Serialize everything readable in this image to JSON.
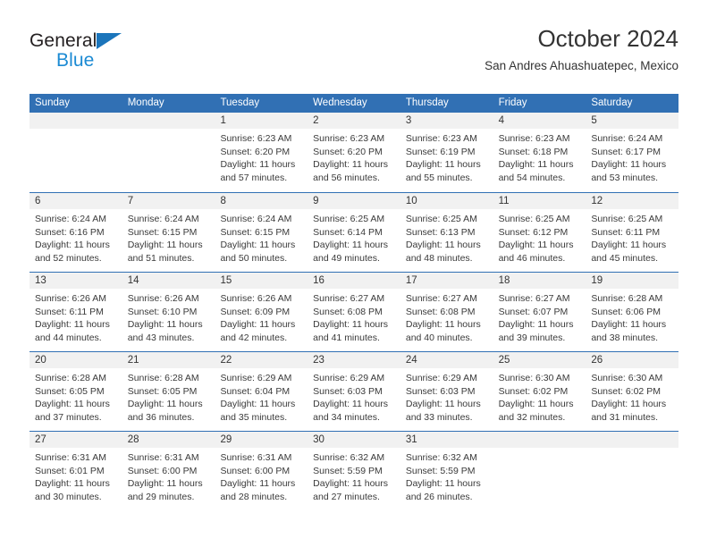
{
  "brand": {
    "name_top": "General",
    "name_bottom": "Blue",
    "triangle_color": "#1b75bb",
    "blue_text_color": "#1b8ad3"
  },
  "header": {
    "title": "October 2024",
    "subtitle": "San Andres Ahuashuatepec, Mexico"
  },
  "theme": {
    "header_blue": "#3170b4",
    "daynum_band": "#f1f1f1",
    "text": "#333333"
  },
  "weekdays": [
    "Sunday",
    "Monday",
    "Tuesday",
    "Wednesday",
    "Thursday",
    "Friday",
    "Saturday"
  ],
  "labels": {
    "sunrise_prefix": "Sunrise: ",
    "sunset_prefix": "Sunset: ",
    "daylight_prefix": "Daylight: "
  },
  "weeks": [
    [
      {
        "day": ""
      },
      {
        "day": ""
      },
      {
        "day": "1",
        "sunrise": "Sunrise: 6:23 AM",
        "sunset": "Sunset: 6:20 PM",
        "daylight": "Daylight: 11 hours and 57 minutes."
      },
      {
        "day": "2",
        "sunrise": "Sunrise: 6:23 AM",
        "sunset": "Sunset: 6:20 PM",
        "daylight": "Daylight: 11 hours and 56 minutes."
      },
      {
        "day": "3",
        "sunrise": "Sunrise: 6:23 AM",
        "sunset": "Sunset: 6:19 PM",
        "daylight": "Daylight: 11 hours and 55 minutes."
      },
      {
        "day": "4",
        "sunrise": "Sunrise: 6:23 AM",
        "sunset": "Sunset: 6:18 PM",
        "daylight": "Daylight: 11 hours and 54 minutes."
      },
      {
        "day": "5",
        "sunrise": "Sunrise: 6:24 AM",
        "sunset": "Sunset: 6:17 PM",
        "daylight": "Daylight: 11 hours and 53 minutes."
      }
    ],
    [
      {
        "day": "6",
        "sunrise": "Sunrise: 6:24 AM",
        "sunset": "Sunset: 6:16 PM",
        "daylight": "Daylight: 11 hours and 52 minutes."
      },
      {
        "day": "7",
        "sunrise": "Sunrise: 6:24 AM",
        "sunset": "Sunset: 6:15 PM",
        "daylight": "Daylight: 11 hours and 51 minutes."
      },
      {
        "day": "8",
        "sunrise": "Sunrise: 6:24 AM",
        "sunset": "Sunset: 6:15 PM",
        "daylight": "Daylight: 11 hours and 50 minutes."
      },
      {
        "day": "9",
        "sunrise": "Sunrise: 6:25 AM",
        "sunset": "Sunset: 6:14 PM",
        "daylight": "Daylight: 11 hours and 49 minutes."
      },
      {
        "day": "10",
        "sunrise": "Sunrise: 6:25 AM",
        "sunset": "Sunset: 6:13 PM",
        "daylight": "Daylight: 11 hours and 48 minutes."
      },
      {
        "day": "11",
        "sunrise": "Sunrise: 6:25 AM",
        "sunset": "Sunset: 6:12 PM",
        "daylight": "Daylight: 11 hours and 46 minutes."
      },
      {
        "day": "12",
        "sunrise": "Sunrise: 6:25 AM",
        "sunset": "Sunset: 6:11 PM",
        "daylight": "Daylight: 11 hours and 45 minutes."
      }
    ],
    [
      {
        "day": "13",
        "sunrise": "Sunrise: 6:26 AM",
        "sunset": "Sunset: 6:11 PM",
        "daylight": "Daylight: 11 hours and 44 minutes."
      },
      {
        "day": "14",
        "sunrise": "Sunrise: 6:26 AM",
        "sunset": "Sunset: 6:10 PM",
        "daylight": "Daylight: 11 hours and 43 minutes."
      },
      {
        "day": "15",
        "sunrise": "Sunrise: 6:26 AM",
        "sunset": "Sunset: 6:09 PM",
        "daylight": "Daylight: 11 hours and 42 minutes."
      },
      {
        "day": "16",
        "sunrise": "Sunrise: 6:27 AM",
        "sunset": "Sunset: 6:08 PM",
        "daylight": "Daylight: 11 hours and 41 minutes."
      },
      {
        "day": "17",
        "sunrise": "Sunrise: 6:27 AM",
        "sunset": "Sunset: 6:08 PM",
        "daylight": "Daylight: 11 hours and 40 minutes."
      },
      {
        "day": "18",
        "sunrise": "Sunrise: 6:27 AM",
        "sunset": "Sunset: 6:07 PM",
        "daylight": "Daylight: 11 hours and 39 minutes."
      },
      {
        "day": "19",
        "sunrise": "Sunrise: 6:28 AM",
        "sunset": "Sunset: 6:06 PM",
        "daylight": "Daylight: 11 hours and 38 minutes."
      }
    ],
    [
      {
        "day": "20",
        "sunrise": "Sunrise: 6:28 AM",
        "sunset": "Sunset: 6:05 PM",
        "daylight": "Daylight: 11 hours and 37 minutes."
      },
      {
        "day": "21",
        "sunrise": "Sunrise: 6:28 AM",
        "sunset": "Sunset: 6:05 PM",
        "daylight": "Daylight: 11 hours and 36 minutes."
      },
      {
        "day": "22",
        "sunrise": "Sunrise: 6:29 AM",
        "sunset": "Sunset: 6:04 PM",
        "daylight": "Daylight: 11 hours and 35 minutes."
      },
      {
        "day": "23",
        "sunrise": "Sunrise: 6:29 AM",
        "sunset": "Sunset: 6:03 PM",
        "daylight": "Daylight: 11 hours and 34 minutes."
      },
      {
        "day": "24",
        "sunrise": "Sunrise: 6:29 AM",
        "sunset": "Sunset: 6:03 PM",
        "daylight": "Daylight: 11 hours and 33 minutes."
      },
      {
        "day": "25",
        "sunrise": "Sunrise: 6:30 AM",
        "sunset": "Sunset: 6:02 PM",
        "daylight": "Daylight: 11 hours and 32 minutes."
      },
      {
        "day": "26",
        "sunrise": "Sunrise: 6:30 AM",
        "sunset": "Sunset: 6:02 PM",
        "daylight": "Daylight: 11 hours and 31 minutes."
      }
    ],
    [
      {
        "day": "27",
        "sunrise": "Sunrise: 6:31 AM",
        "sunset": "Sunset: 6:01 PM",
        "daylight": "Daylight: 11 hours and 30 minutes."
      },
      {
        "day": "28",
        "sunrise": "Sunrise: 6:31 AM",
        "sunset": "Sunset: 6:00 PM",
        "daylight": "Daylight: 11 hours and 29 minutes."
      },
      {
        "day": "29",
        "sunrise": "Sunrise: 6:31 AM",
        "sunset": "Sunset: 6:00 PM",
        "daylight": "Daylight: 11 hours and 28 minutes."
      },
      {
        "day": "30",
        "sunrise": "Sunrise: 6:32 AM",
        "sunset": "Sunset: 5:59 PM",
        "daylight": "Daylight: 11 hours and 27 minutes."
      },
      {
        "day": "31",
        "sunrise": "Sunrise: 6:32 AM",
        "sunset": "Sunset: 5:59 PM",
        "daylight": "Daylight: 11 hours and 26 minutes."
      },
      {
        "day": ""
      },
      {
        "day": ""
      }
    ]
  ]
}
